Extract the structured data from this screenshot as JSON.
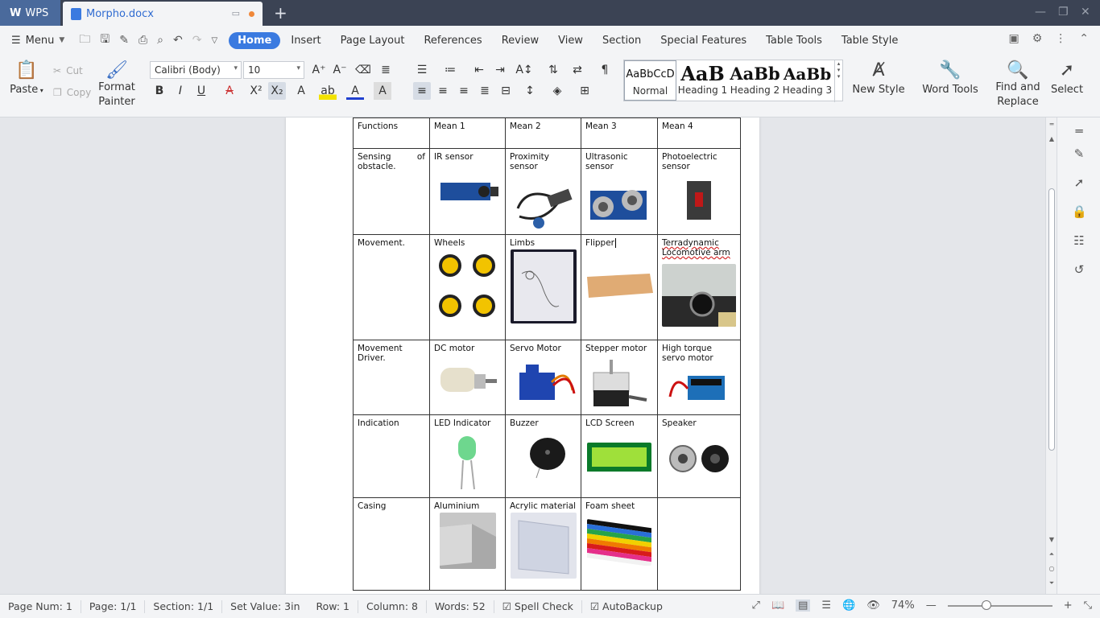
{
  "titlebar": {
    "app_label": "WPS",
    "doc_tab": "Morpho.docx"
  },
  "menu": {
    "menu_label": "Menu",
    "tabs": [
      "Home",
      "Insert",
      "Page Layout",
      "References",
      "Review",
      "View",
      "Section",
      "Special Features",
      "Table Tools",
      "Table Style"
    ]
  },
  "ribbon": {
    "paste": "Paste",
    "cut": "Cut",
    "copy": "Copy",
    "format_painter": "Format Painter",
    "font": "Calibri (Body)",
    "size": "10",
    "styles": [
      {
        "preview": "AaBbCcD",
        "name": "Normal"
      },
      {
        "preview": "AaB",
        "name": "Heading 1"
      },
      {
        "preview": "AaBb",
        "name": "Heading 2"
      },
      {
        "preview": "AaBb",
        "name": "Heading 3"
      }
    ],
    "new_style": "New Style",
    "word_tools": "Word Tools",
    "find_replace": "Find and Replace",
    "select": "Select"
  },
  "table": {
    "rows": [
      [
        "Functions",
        "Mean 1",
        "Mean 2",
        "Mean 3",
        "Mean 4"
      ],
      [
        "Sensing of obstacle.",
        "IR sensor",
        "Proximity sensor",
        "Ultrasonic sensor",
        "Photoelectric sensor"
      ],
      [
        "Movement.",
        "Wheels",
        "Limbs",
        "Flipper",
        "Terradynamic Locomotive arm"
      ],
      [
        "Movement Driver.",
        "DC motor",
        "Servo Motor",
        "Stepper motor",
        "High torque servo motor"
      ],
      [
        "Indication",
        "LED Indicator",
        "Buzzer",
        "LCD Screen",
        "Speaker"
      ],
      [
        "Casing",
        "Aluminium",
        "Acrylic material",
        "Foam sheet",
        ""
      ]
    ]
  },
  "status": {
    "page_num": "Page Num: 1",
    "page": "Page: 1/1",
    "section": "Section: 1/1",
    "set_value": "Set Value: 3in",
    "row": "Row: 1",
    "column": "Column: 8",
    "words": "Words: 52",
    "spell_check": "Spell Check",
    "autobackup": "AutoBackup",
    "zoom": "74%"
  },
  "colors": {
    "accent": "#3a7ae0",
    "titlebar": "#3b4354"
  }
}
